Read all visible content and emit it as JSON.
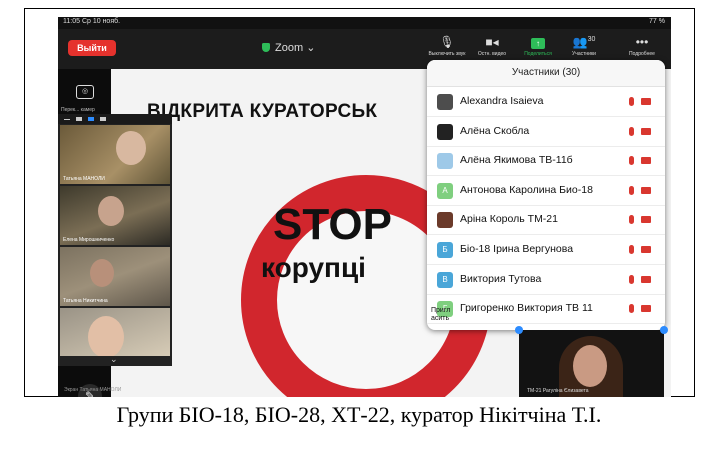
{
  "status_bar": {
    "time": "11:05  Ср 10 нояб.",
    "system": "77 %"
  },
  "toolbar": {
    "leave_label": "Выйти",
    "app_name": "Zoom",
    "mute_label": "Выключить звук",
    "video_label": "Остн. видео",
    "share_label": "Поделиться",
    "participants_label": "Участники",
    "participants_count": "30",
    "more_label": "Подробнее"
  },
  "sidebar": {
    "camera_label": "Перек... камер"
  },
  "slide": {
    "heading": "ВІДКРИТА КУРАТОРСЬК",
    "stop_word": "STOP",
    "sub_word": "корупці"
  },
  "video_tiles": [
    {
      "name": "Татьяна МАНОЛИ"
    },
    {
      "name": "Елена Мирошниченко"
    },
    {
      "name": "Татьяна Никитчина"
    },
    {
      "name": ""
    }
  ],
  "participants_panel": {
    "title": "Участники (30)",
    "invite_label": "Пригл\nасить",
    "items": [
      {
        "name": "Alexandra Isaieva",
        "initial": "",
        "color": "#4d4d4d"
      },
      {
        "name": "Алёна Скобла",
        "initial": "",
        "color": "#222222"
      },
      {
        "name": "Алёна Якимова ТВ-11б",
        "initial": "",
        "color": "#9ec9e8"
      },
      {
        "name": "Антонова Каролина Био-18",
        "initial": "А",
        "color": "#7fcf7f"
      },
      {
        "name": "Аріна Король ТМ-21",
        "initial": "",
        "color": "#6b3a2a"
      },
      {
        "name": "Біо-18 Ірина Вергунова",
        "initial": "Б",
        "color": "#4aa6d8"
      },
      {
        "name": "Виктория Тутова",
        "initial": "В",
        "color": "#4aa6d8"
      },
      {
        "name": "Григоренко Виктория ТВ 11",
        "initial": "Г",
        "color": "#7fcf7f"
      }
    ]
  },
  "pip": {
    "name": "ТМ-21 Рагуліна Єлизавета"
  },
  "own_label": "Экран Татьяна МАНОЛИ",
  "caption": "Групи БІО-18, БІО-28, ХТ-22, куратор Нікітчіна Т.І."
}
